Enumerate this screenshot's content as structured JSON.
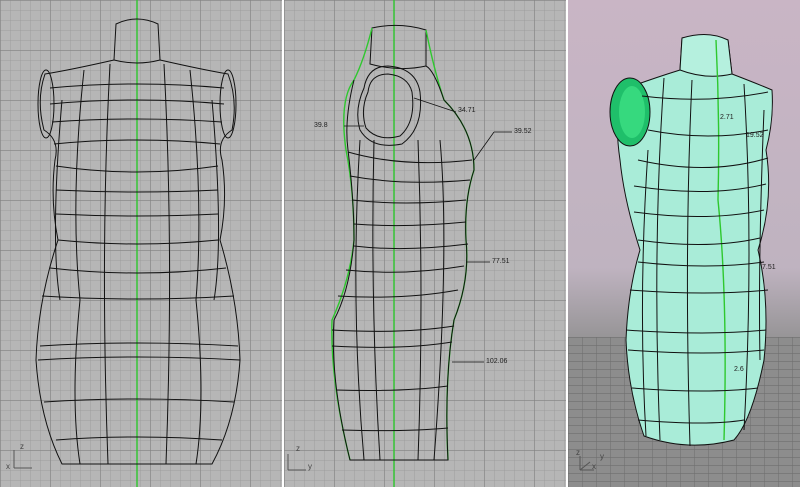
{
  "viewports": {
    "front": {
      "axes": {
        "x": "x",
        "z": "z"
      }
    },
    "right": {
      "axes": {
        "y": "y",
        "z": "z"
      },
      "dimensions": [
        {
          "value": "39.8"
        },
        {
          "value": "34.71"
        },
        {
          "value": "39.52"
        },
        {
          "value": "77.51"
        },
        {
          "value": "102.06"
        }
      ]
    },
    "perspective": {
      "axes": {
        "x": "x",
        "y": "y",
        "z": "z"
      },
      "dimensions": [
        {
          "value": "2.71"
        },
        {
          "value": "19.52"
        },
        {
          "value": "7.51"
        },
        {
          "value": "2.6"
        }
      ]
    }
  },
  "colors": {
    "viewport_bg": "#b6b6b6",
    "wireframe": "#111111",
    "highlight": "#2ec82e",
    "surface": "#a9ecd8"
  }
}
